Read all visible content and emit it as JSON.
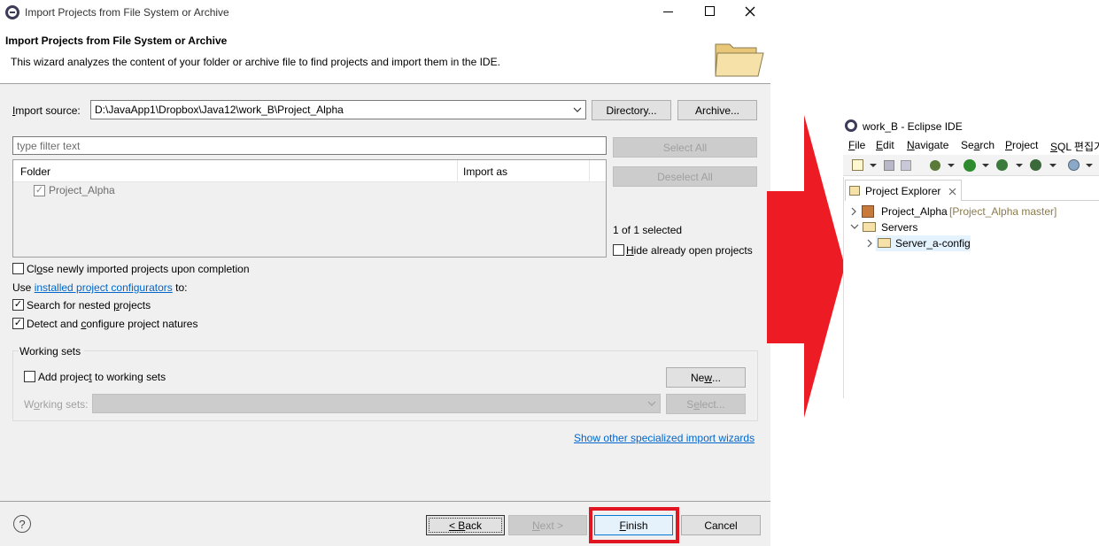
{
  "dialog": {
    "window_title": "Import Projects from File System or Archive",
    "header_title": "Import Projects from File System or Archive",
    "header_description": "This wizard analyzes the content of your folder or archive file to find projects and import them in the IDE.",
    "import_source_label": "Import source:",
    "import_source_value": "D:\\JavaApp1\\Dropbox\\Java12\\work_B\\Project_Alpha",
    "directory_button": "Directory...",
    "archive_button": "Archive...",
    "filter_placeholder": "type filter text",
    "select_all_button": "Select All",
    "deselect_all_button": "Deselect All",
    "table": {
      "headers": [
        "Folder",
        "Import as"
      ],
      "rows": [
        {
          "folder": "Project_Alpha",
          "import_as": "",
          "checked": true
        }
      ]
    },
    "selection_count": "1 of 1 selected",
    "hide_open_projects_label": "Hide already open projects",
    "close_newly_label": "Close newly imported projects upon completion",
    "use_prefix": "Use",
    "configurators_link": "installed project configurators",
    "use_suffix": "to:",
    "search_nested_label": "Search for nested projects",
    "detect_natures_label": "Detect and configure project natures",
    "working_sets": {
      "group_label": "Working sets",
      "add_label": "Add project to working sets",
      "new_button": "New...",
      "sets_label": "Working sets:",
      "select_button": "Select..."
    },
    "show_other_link": "Show other specialized import wizards",
    "back_button": "< Back",
    "next_button": "Next >",
    "finish_button": "Finish",
    "cancel_button": "Cancel",
    "highlight_color": "#e0151f"
  },
  "ide": {
    "window_title": "work_B - Eclipse IDE",
    "menu": [
      "File",
      "Edit",
      "Navigate",
      "Search",
      "Project",
      "SQL 편집기"
    ],
    "view_tab": "Project Explorer",
    "tree": [
      {
        "label": "Project_Alpha",
        "decoration": "[Project_Alpha master]"
      },
      {
        "label": "Servers"
      },
      {
        "label": "Server_a-config"
      }
    ]
  },
  "arrow_color": "#ed1c24"
}
